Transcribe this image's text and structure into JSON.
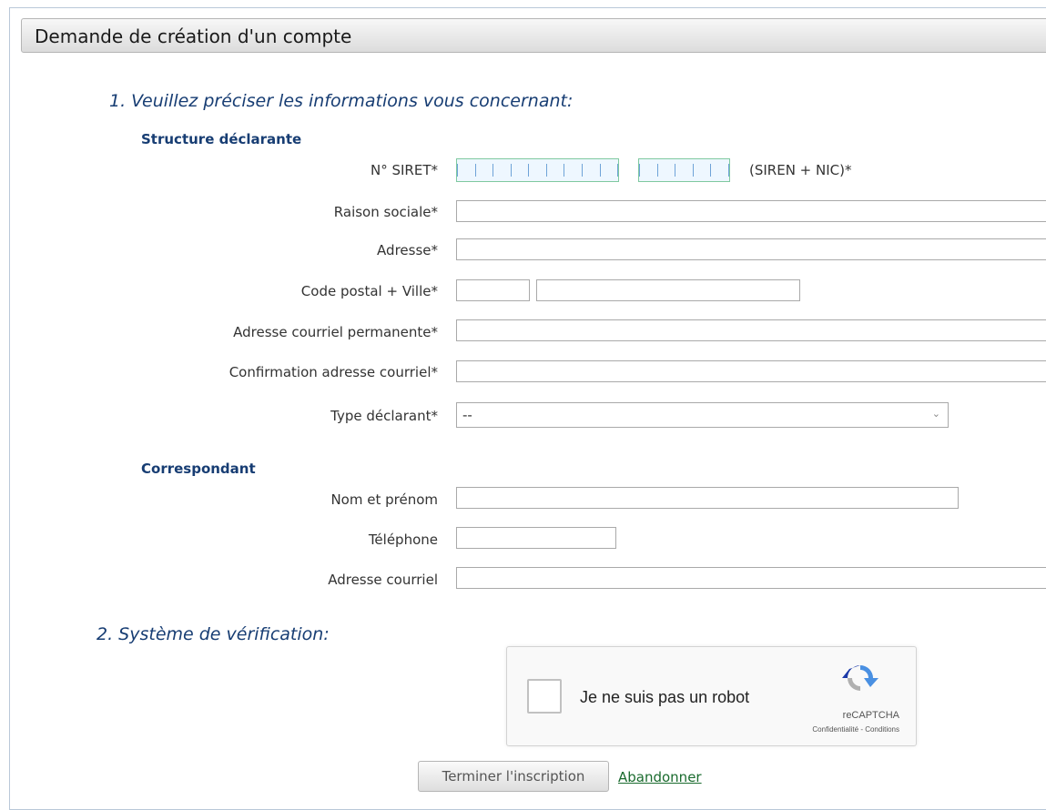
{
  "panel": {
    "title": "Demande de création d'un compte"
  },
  "section1": {
    "title": "1. Veuillez préciser les informations vous concernant:",
    "structure": {
      "title": "Structure déclarante",
      "siret_label": "N° SIRET*",
      "siret_note": "(SIREN + NIC)*",
      "raison_label": "Raison sociale*",
      "adresse_label": "Adresse*",
      "cp_ville_label": "Code postal + Ville*",
      "courriel_label": "Adresse courriel permanente*",
      "confirm_label": "Confirmation adresse courriel*",
      "type_label": "Type déclarant*",
      "type_value": "--"
    },
    "correspondant": {
      "title": "Correspondant",
      "nom_label": "Nom et prénom",
      "tel_label": "Téléphone",
      "courriel_label": "Adresse courriel"
    }
  },
  "section2": {
    "title": "2. Système de vérification:",
    "captcha_label": "Je ne suis pas un robot",
    "captcha_brand": "reCAPTCHA",
    "captcha_links": "Confidentialité - Conditions"
  },
  "actions": {
    "submit_label": "Terminer l'inscription",
    "cancel_label": "Abandonner"
  },
  "colors": {
    "section_title": "#173d73",
    "link": "#1a6b2e",
    "siret_border": "#7fc9a0"
  }
}
